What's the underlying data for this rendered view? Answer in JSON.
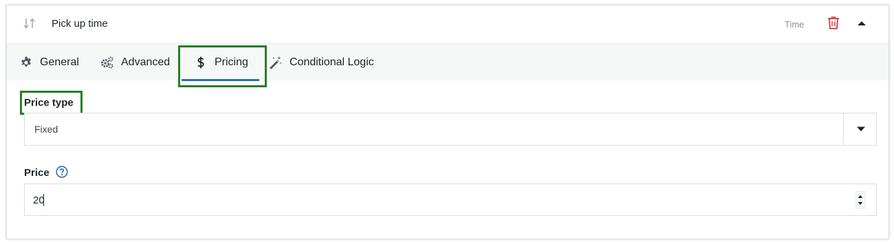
{
  "field": {
    "title": "Pick up time",
    "type_badge": "Time"
  },
  "tabs": [
    {
      "label": "General",
      "icon": "gear-icon"
    },
    {
      "label": "Advanced",
      "icon": "gears-icon"
    },
    {
      "label": "Pricing",
      "icon": "dollar-icon",
      "active": true
    },
    {
      "label": "Conditional Logic",
      "icon": "magic-wand-icon"
    }
  ],
  "pricing": {
    "price_type_label": "Price type",
    "price_type_value": "Fixed",
    "price_label": "Price",
    "price_value": "20"
  },
  "colors": {
    "accent": "#2271b1",
    "highlight": "#238024",
    "danger": "#d63638"
  }
}
